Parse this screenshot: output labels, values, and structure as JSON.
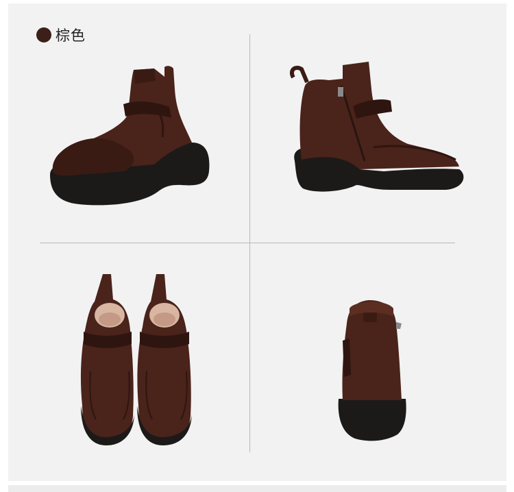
{
  "color_option": {
    "label": "棕色",
    "swatch_color": "#3c1f17"
  },
  "photos": [
    {
      "view": "side-left",
      "icon": "boot-side-icon"
    },
    {
      "view": "side-right-zipper",
      "icon": "boot-zipper-side-icon"
    },
    {
      "view": "front-pair",
      "icon": "boot-pair-front-icon"
    },
    {
      "view": "back",
      "icon": "boot-back-icon"
    }
  ],
  "colors": {
    "leather": "#4a231b",
    "leather_dark": "#2e1510",
    "sole": "#1c1a19",
    "lining": "#d9b6a2",
    "panel_bg": "#f2f2f2"
  }
}
